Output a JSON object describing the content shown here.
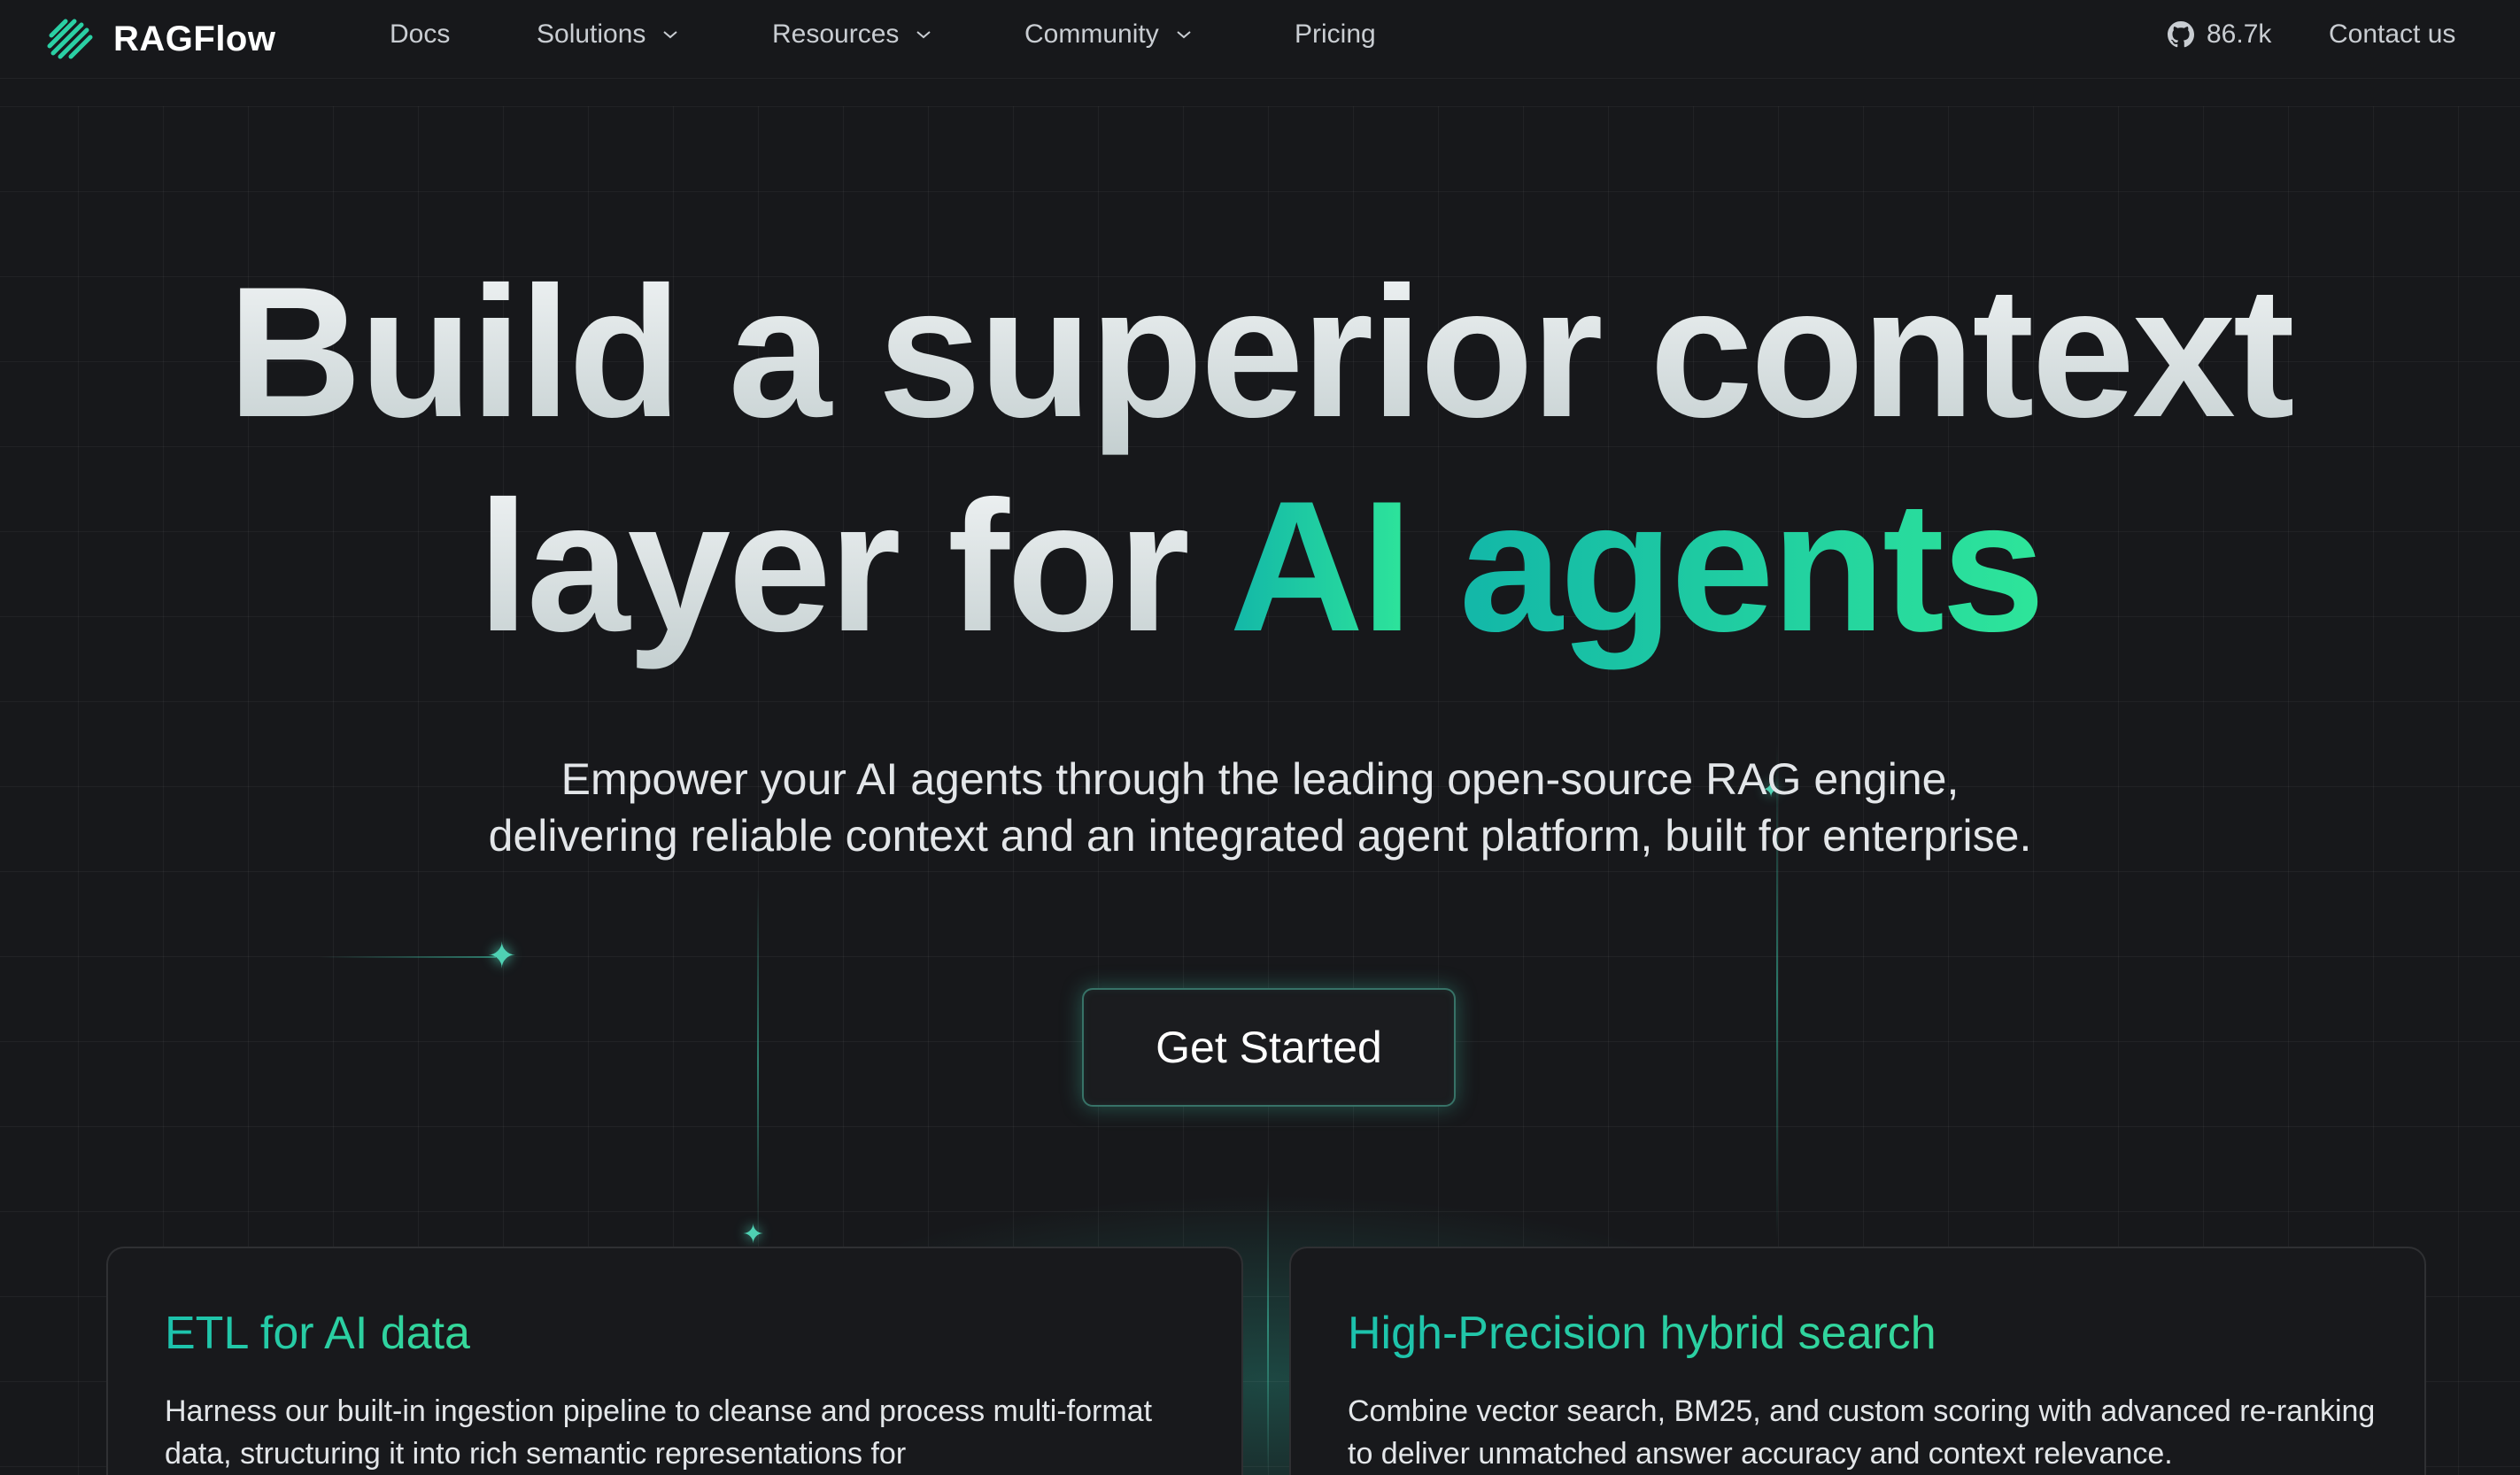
{
  "brand": {
    "name": "RAGFlow"
  },
  "nav": {
    "docs": "Docs",
    "solutions": "Solutions",
    "resources": "Resources",
    "community": "Community",
    "pricing": "Pricing",
    "github_stars": "86.7k",
    "contact": "Contact us"
  },
  "hero": {
    "title_line1": "Build a superior context",
    "title_line2_plain": "layer for ",
    "title_line2_ai": "AI",
    "title_line2_agents": "agents",
    "subtitle_line1": "Empower your AI agents through the leading open-source RAG engine,",
    "subtitle_line2": "delivering reliable context and an integrated agent platform, built for enterprise.",
    "cta": "Get Started"
  },
  "features": [
    {
      "title": "ETL for AI data",
      "text": "Harness our built-in ingestion pipeline to cleanse and process multi-format data, structuring it into rich semantic representations for"
    },
    {
      "title": "High-Precision hybrid search",
      "text": "Combine vector search, BM25, and custom scoring with advanced re-ranking to deliver unmatched answer accuracy and context relevance."
    }
  ],
  "colors": {
    "background": "#17181b",
    "accent_start": "#13b7a8",
    "accent_end": "#2ee59a"
  },
  "icons": [
    "ragflow-logo-icon",
    "chevron-down-icon",
    "github-icon"
  ]
}
